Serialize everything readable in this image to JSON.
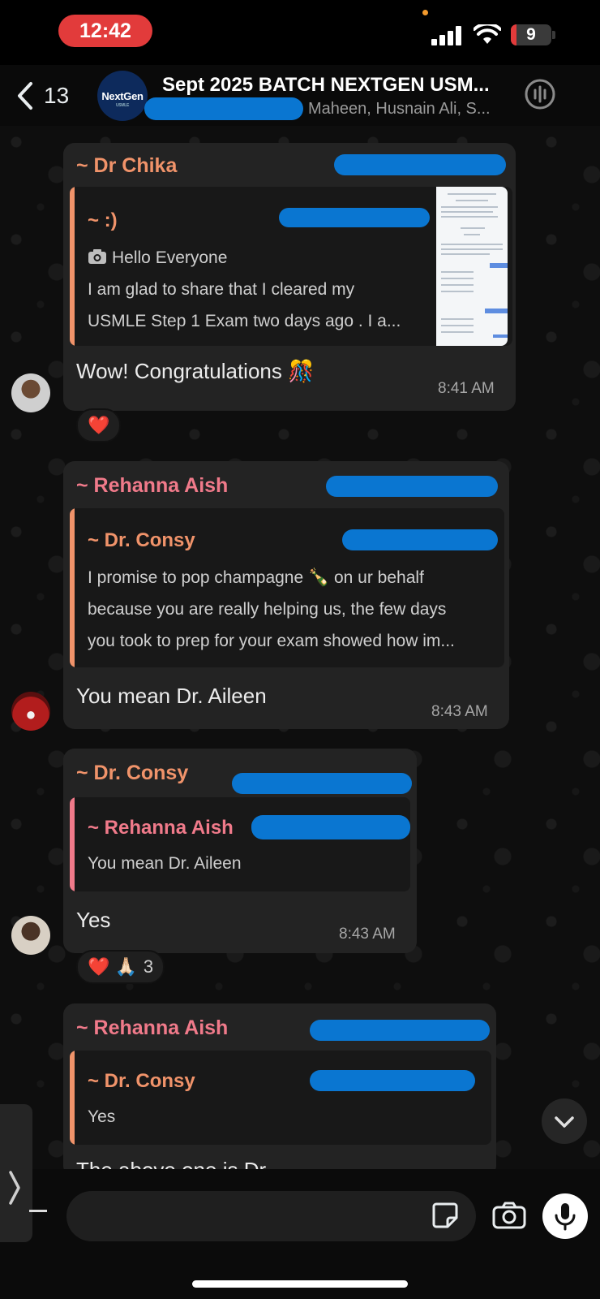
{
  "status_bar": {
    "time": "12:42",
    "battery": "9",
    "battery_level_percent": 9
  },
  "header": {
    "back_count": "13",
    "group_avatar_text": "NextGen",
    "group_avatar_sub": "USMLE",
    "title": "Sept  2025 BATCH NEXTGEN USM...",
    "members": "Maheen, Husnain Ali, S..."
  },
  "messages": [
    {
      "sender": "~ Dr Chika",
      "quote_sender": "~ :)",
      "quote_lines": [
        "Hello Everyone",
        "I am glad to share that I cleared my",
        "USMLE Step 1 Exam two days ago  . I a..."
      ],
      "text": "Wow! Congratulations 🎊",
      "time": "8:41 AM",
      "reactions": "❤️"
    },
    {
      "sender": "~ Rehanna Aish",
      "quote_sender": "~ Dr. Consy",
      "quote_lines": [
        "I promise to pop champagne 🍾 on ur behalf",
        "because you are really helping us,  the few days",
        "you took to prep for your exam showed how im..."
      ],
      "text": "You mean Dr. Aileen",
      "time": "8:43 AM"
    },
    {
      "sender": "~ Dr. Consy",
      "quote_sender": "~ Rehanna Aish",
      "quote_lines": [
        "You mean Dr. Aileen"
      ],
      "text": "Yes",
      "time": "8:43 AM",
      "reactions": "❤️ 🙏🏻",
      "reaction_count": "3"
    },
    {
      "sender": "~ Rehanna Aish",
      "quote_sender": "~ Dr. Consy",
      "quote_lines": [
        "Yes"
      ],
      "text": "The above one is Dr."
    }
  ],
  "colors": {
    "chika": "#f0936a",
    "rehanna": "#f07a8a",
    "consy": "#f0936a",
    "redaction": "#0a76d1",
    "status_pill": "#e23b3b"
  }
}
